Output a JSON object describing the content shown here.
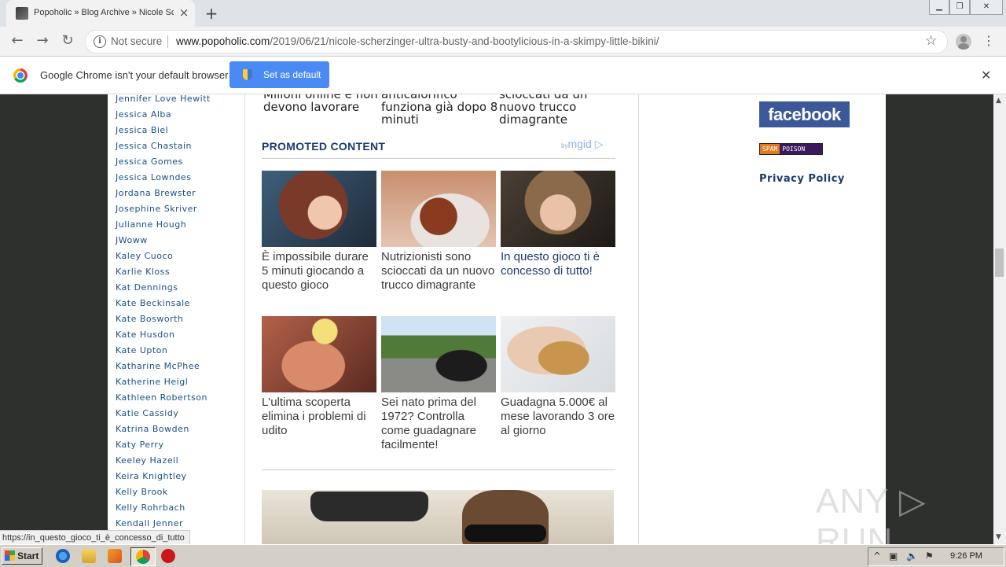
{
  "browser": {
    "tab_title": "Popoholic » Blog Archive » Nicole Scherzinger",
    "tab_close": "×",
    "new_tab": "+",
    "window_controls": [
      "▁",
      "❐",
      "✕"
    ],
    "security_label": "Not secure",
    "url_host": "www.popoholic.com",
    "url_path": "/2019/06/21/nicole-scherzinger-ultra-busty-and-bootylicious-in-a-skimpy-little-bikini/",
    "icons": {
      "back": "←",
      "forward": "→",
      "reload": "↻",
      "star": "☆",
      "menu": "⋮"
    }
  },
  "infobar": {
    "message": "Google Chrome isn't your default browser",
    "button_label": "Set as default",
    "close": "✕"
  },
  "sidebar": {
    "names": [
      "Jennifer Love Hewitt",
      "Jessica Alba",
      "Jessica Biel",
      "Jessica Chastain",
      "Jessica Gomes",
      "Jessica Lowndes",
      "Jordana Brewster",
      "Josephine Skriver",
      "Julianne Hough",
      "JWoww",
      "Kaley Cuoco",
      "Karlie Kloss",
      "Kat Dennings",
      "Kate Beckinsale",
      "Kate Bosworth",
      "Kate Husdon",
      "Kate Upton",
      "Katharine McPhee",
      "Katherine Heigl",
      "Kathleen Robertson",
      "Katie Cassidy",
      "Katrina Bowden",
      "Katy Perry",
      "Keeley Hazell",
      "Keira Knightley",
      "Kelly Brook",
      "Kelly Rohrbach",
      "Kendall Jenner"
    ]
  },
  "center": {
    "top_fragments": [
      "Milioni online e non devono lavorare",
      "anticalorifico funziona già dopo 8 minuti",
      "scioccati da un nuovo trucco dimagrante"
    ],
    "promo_heading": "PROMOTED CONTENT",
    "mgid_by": "by",
    "mgid_brand": "mgid ▷",
    "cards": [
      {
        "title": "È impossibile durare 5 minuti giocando a questo gioco",
        "dark": false
      },
      {
        "title": "Nutrizionisti sono scioccati da un nuovo trucco dimagrante",
        "dark": false
      },
      {
        "title": "In questo gioco ti è concesso di tutto!",
        "dark": true
      },
      {
        "title": "L'ultima scoperta elimina i problemi di udito",
        "dark": false
      },
      {
        "title": "Sei nato prima del 1972? Controlla come guadagnare facilmente!",
        "dark": false
      },
      {
        "title": "Guadagna 5.000€ al mese lavorando 3 ore al giorno",
        "dark": false
      }
    ]
  },
  "right": {
    "facebook": "facebook",
    "spam_a": "SPAM",
    "spam_b": "POISON",
    "privacy": "Privacy Policy"
  },
  "status_url": "https://in_questo_gioco_ti_è_concesso_di_tutto",
  "watermark": "ANY ▷ RUN",
  "taskbar": {
    "start": "Start",
    "clock": "9:26 PM",
    "tray_icons": [
      "^",
      "▣",
      "🔈",
      "⚑"
    ]
  }
}
